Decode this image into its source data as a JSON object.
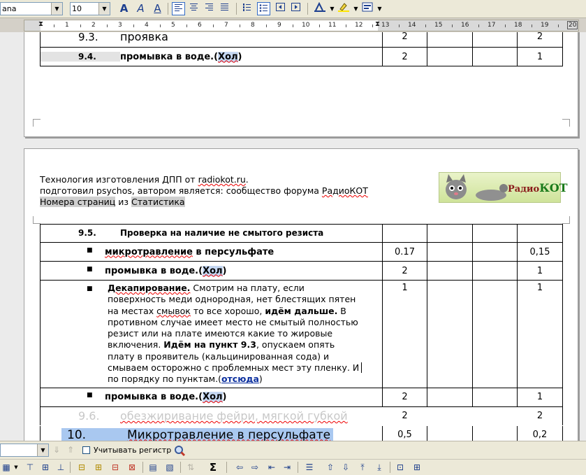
{
  "toolbar": {
    "font_name": "ana",
    "font_size": "10"
  },
  "ruler": {
    "ticks": [
      "1",
      "2",
      "3",
      "4",
      "5",
      "6",
      "7",
      "8",
      "9",
      "10",
      "11",
      "12",
      "13",
      "14",
      "15",
      "16",
      "17",
      "18",
      "19",
      "20"
    ]
  },
  "page1": {
    "rows": [
      {
        "no": "9.3.",
        "text": "проявка",
        "col3": "2",
        "col6": "2"
      },
      {
        "no": "9.4.",
        "text_prefix": "промывка в воде.(",
        "highlight": "Хол",
        "text_suffix": ")",
        "col3": "2",
        "col6": "1"
      }
    ]
  },
  "page2": {
    "header": {
      "line1_prefix": "Технология изготовления ДПП от ",
      "line1_link": "radiokot.ru",
      "line1_suffix": ".",
      "line2_prefix": "подготовил psychos, автором является: сообщество форума ",
      "line2_link": "РадиоКОТ",
      "line3_field1": "Номера страниц",
      "line3_mid": " из ",
      "line3_field2": "Статистика",
      "logo_text_radio": "Радио",
      "logo_text_kot": "КОТ"
    },
    "rows": [
      {
        "no": "9.5.",
        "text": "Проверка на наличие не смытого резиста"
      },
      {
        "text_prefix": "микротравление",
        "text_suffix": " в персульфате",
        "col3": "0.17",
        "col6": "0,15"
      },
      {
        "text_prefix": "промывка в воде.(",
        "highlight": "Хол",
        "text_suffix": ")",
        "col3": "2",
        "col6": "1"
      },
      {
        "lines": [
          "Смотрим на плату, если",
          "поверхность меди однородная, нет блестящих пятен",
          "на местах ",
          " то все хорошо, ",
          " В",
          "противном случае имеет место не смытый полностью",
          "резист или на плате имеются какие то жировые",
          "включения. ",
          ", опускаем опять",
          "плату в проявитель (кальцинированная сода) и",
          "смываем осторожно с проблемных мест эту пленку. И",
          "по порядку по пунктам.(",
          ")"
        ],
        "bold_start": "Декапирование.",
        "spell_word": "смывок",
        "bold_mid": "идём дальше.",
        "bold_goto": "Идём на пункт 9.3",
        "link": "отсюда",
        "col3": "1",
        "col6": "1"
      },
      {
        "text_prefix": "промывка в воде.(",
        "highlight": "Хол",
        "text_suffix": ")",
        "col3": "2",
        "col6": "1"
      },
      {
        "no": "9.6.",
        "text": "обезжиривание фейри, мягкой губкой",
        "col3": "2",
        "col6": "2"
      },
      {
        "no": "10.",
        "text": "Микротравление в персульфате",
        "col3": "0,5",
        "col6": "0,2"
      }
    ]
  },
  "findbar": {
    "match_case_label": "Учитывать регистр"
  },
  "colors": {
    "highlight": "#c5d7f2",
    "section_highlight": "#a9c8f0",
    "field_gray": "#cfcfcf"
  }
}
